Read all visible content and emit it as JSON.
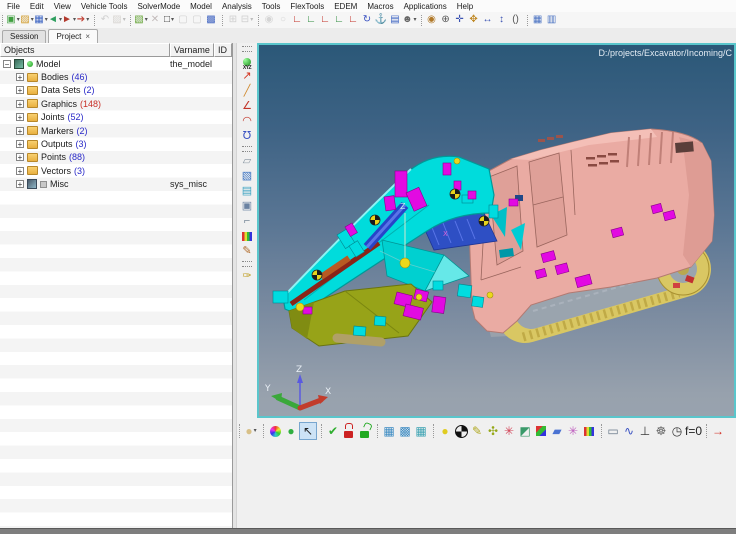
{
  "menu_bar": {
    "items": [
      "File",
      "Edit",
      "View",
      "Vehicle Tools",
      "SolverMode",
      "Model",
      "Analysis",
      "Tools",
      "FlexTools",
      "EDEM",
      "Macros",
      "Applications",
      "Help"
    ]
  },
  "top_toolbar": {
    "groups": [
      [
        {
          "name": "new-model",
          "glyph": "▣",
          "color": "#3f9f3f",
          "dropdown": true
        },
        {
          "name": "open-model",
          "glyph": "▨",
          "color": "#d09a28",
          "dropdown": true
        },
        {
          "name": "save-model",
          "glyph": "▦",
          "color": "#3a62c2",
          "dropdown": true
        },
        {
          "name": "import-file",
          "glyph": "◄",
          "color": "#2f9f5f",
          "dropdown": true
        },
        {
          "name": "export-file",
          "glyph": "►",
          "color": "#b23a2e",
          "dropdown": true
        },
        {
          "name": "export-video",
          "glyph": "➔",
          "color": "#c24438",
          "dropdown": true
        }
      ],
      [
        {
          "name": "undo",
          "glyph": "↶",
          "color": "#888",
          "dis": true
        },
        {
          "name": "open-recent",
          "glyph": "▨",
          "color": "#c09040",
          "dis": true,
          "dropdown": true
        }
      ],
      [
        {
          "name": "new-window",
          "glyph": "▧",
          "color": "#5fa02f",
          "dropdown": true
        },
        {
          "name": "delete",
          "glyph": "✕",
          "color": "#c23428",
          "dis": true
        },
        {
          "name": "select-rectangle",
          "glyph": "□",
          "color": "#333",
          "dropdown": true
        },
        {
          "name": "undo-view",
          "glyph": "▢",
          "color": "#888",
          "dis": true
        },
        {
          "name": "redo-view",
          "glyph": "▢",
          "color": "#888",
          "dis": true
        },
        {
          "name": "screen-capture",
          "glyph": "▩",
          "color": "#3e62c0"
        }
      ],
      [
        {
          "name": "copy",
          "glyph": "⊞",
          "color": "#888",
          "dis": true
        },
        {
          "name": "paste",
          "glyph": "⊟",
          "color": "#888",
          "dis": true,
          "dropdown": true
        }
      ],
      [
        {
          "name": "zoom-previous",
          "glyph": "◉",
          "color": "#999",
          "dis": true
        },
        {
          "name": "zoom-next",
          "glyph": "○",
          "color": "#999",
          "dis": true
        },
        {
          "name": "view-front",
          "glyph": "∟",
          "color": "#c22c22"
        },
        {
          "name": "view-right",
          "glyph": "∟",
          "color": "#2a8a3a"
        },
        {
          "name": "view-top",
          "glyph": "∟",
          "color": "#c22c22"
        },
        {
          "name": "view-iso",
          "glyph": "∟",
          "color": "#2a8a3a"
        },
        {
          "name": "view-bottom",
          "glyph": "∟",
          "color": "#c22c22"
        },
        {
          "name": "view-rotate",
          "glyph": "↻",
          "color": "#3a52c2"
        },
        {
          "name": "view-anchor",
          "glyph": "⚓",
          "color": "#2a52a2"
        },
        {
          "name": "render-page",
          "glyph": "▤",
          "color": "#3a62c2"
        },
        {
          "name": "browser-person",
          "glyph": "☻",
          "color": "#666",
          "dropdown": true
        }
      ],
      [
        {
          "name": "zoom-dynamic",
          "glyph": "◉",
          "color": "#b07828"
        },
        {
          "name": "zoom-in-out",
          "glyph": "⊕",
          "color": "#555"
        },
        {
          "name": "translate-view",
          "glyph": "✛",
          "color": "#3a52b2"
        },
        {
          "name": "pan-view",
          "glyph": "✥",
          "color": "#c08a28"
        },
        {
          "name": "fit-horizontal",
          "glyph": "↔",
          "color": "#3a52b2"
        },
        {
          "name": "fit-vertical",
          "glyph": "↕",
          "color": "#3a52b2"
        },
        {
          "name": "perspective",
          "glyph": "()",
          "color": "#555"
        }
      ],
      [
        {
          "name": "tile-windows",
          "glyph": "▦",
          "color": "#4a72c2"
        },
        {
          "name": "cascade-windows",
          "glyph": "▥",
          "color": "#4a72c2"
        }
      ]
    ]
  },
  "panel_tabs": {
    "session": "Session",
    "project": "Project",
    "close": "×"
  },
  "tree": {
    "headers": [
      "Objects",
      "Varname",
      "ID"
    ],
    "items": [
      {
        "label": "Model",
        "count": "",
        "varname": "the_model",
        "expander": "−"
      },
      {
        "label": "Bodies",
        "count": "(46)",
        "varname": "",
        "expander": "+"
      },
      {
        "label": "Data Sets",
        "count": "(2)",
        "varname": "",
        "expander": "+"
      },
      {
        "label": "Graphics",
        "count": "(148)",
        "varname": "",
        "expander": "+"
      },
      {
        "label": "Joints",
        "count": "(52)",
        "varname": "",
        "expander": "+"
      },
      {
        "label": "Markers",
        "count": "(2)",
        "varname": "",
        "expander": "+"
      },
      {
        "label": "Outputs",
        "count": "(3)",
        "varname": "",
        "expander": "+"
      },
      {
        "label": "Points",
        "count": "(88)",
        "varname": "",
        "expander": "+"
      },
      {
        "label": "Vectors",
        "count": "(3)",
        "varname": "",
        "expander": "+"
      },
      {
        "label": "Misc",
        "count": "",
        "varname": "sys_misc",
        "expander": "+"
      }
    ]
  },
  "left_toolbar": {
    "groups": [
      [
        {
          "name": "point-xyz",
          "cls": "xyz-ball",
          "sub": "XYZ"
        },
        {
          "name": "arrow-marker",
          "glyph": "↗",
          "color": "#d23420"
        },
        {
          "name": "line-tool",
          "glyph": "╱",
          "color": "#d08a30"
        },
        {
          "name": "polyline-tool",
          "glyph": "∠",
          "color": "#c23428"
        },
        {
          "name": "arc-tool",
          "glyph": "◠",
          "color": "#c23428"
        },
        {
          "name": "spline-tool",
          "glyph": "℧",
          "color": "#3a52c2"
        }
      ],
      [
        {
          "name": "plane-tool",
          "glyph": "▱",
          "color": "#8a96a2"
        },
        {
          "name": "render-settings",
          "glyph": "▧",
          "color": "#3a72c2"
        },
        {
          "name": "appearance-monitor",
          "glyph": "▤",
          "color": "#3aa2c2"
        },
        {
          "name": "view-part",
          "glyph": "▣",
          "color": "#6a82a2"
        },
        {
          "name": "corner-tool",
          "glyph": "⌐",
          "color": "#7a8a9a"
        },
        {
          "name": "measure-ruler",
          "cls": "bars"
        },
        {
          "name": "pencil-sphere",
          "glyph": "✎",
          "color": "#b06a28"
        }
      ],
      [
        {
          "name": "sweep-tool",
          "glyph": "✑",
          "color": "#c0a028"
        }
      ]
    ]
  },
  "viewport": {
    "path_text": "D:/projects/Excavator/Incoming/C",
    "triad": {
      "x": "X",
      "y": "Y",
      "z": "Z"
    },
    "marker_labels": {
      "z": "Z",
      "x": "X"
    }
  },
  "bottom_toolbar": {
    "groups": [
      [
        {
          "name": "render-mode",
          "glyph": "●",
          "color": "#d8c088",
          "dropdown": true
        }
      ],
      [
        {
          "name": "color-wheel",
          "cls": "wheel"
        },
        {
          "name": "shaded-mode",
          "glyph": "●",
          "color": "#2fae3f"
        },
        {
          "name": "select-pointer",
          "glyph": "↖",
          "color": "#222",
          "active": true
        }
      ],
      [
        {
          "name": "verify-check",
          "glyph": "✔",
          "color": "#2fae2f"
        },
        {
          "name": "lock-closed",
          "cls": "lock-red"
        },
        {
          "name": "lock-open",
          "cls": "lock-green"
        }
      ],
      [
        {
          "name": "view-layout-1",
          "glyph": "▦",
          "color": "#3a8ac2"
        },
        {
          "name": "view-layout-2",
          "glyph": "▩",
          "color": "#3a8ac2"
        },
        {
          "name": "view-layout-3",
          "glyph": "▦",
          "color": "#3aa2b2"
        }
      ],
      [
        {
          "name": "sphere-marker",
          "glyph": "●",
          "color": "#e0cc20"
        },
        {
          "name": "inertia-marker",
          "cls": "target"
        },
        {
          "name": "pencil-dart",
          "glyph": "✎",
          "color": "#b0a820"
        },
        {
          "name": "propeller-marker",
          "glyph": "✣",
          "color": "#96a818"
        },
        {
          "name": "star-marker",
          "glyph": "✳",
          "color": "#d24458"
        },
        {
          "name": "plane-stack",
          "glyph": "◩",
          "color": "#3a9a6a"
        },
        {
          "name": "rgb-cube",
          "cls": "cube"
        },
        {
          "name": "blue-plane",
          "glyph": "▰",
          "color": "#4a72d2"
        },
        {
          "name": "asterisk-marker",
          "glyph": "✳",
          "color": "#c060c0"
        },
        {
          "name": "color-bars",
          "cls": "bars"
        }
      ],
      [
        {
          "name": "vehicle-tool",
          "glyph": "▭",
          "color": "#6a7a8a"
        },
        {
          "name": "spring-damper",
          "glyph": "∿",
          "color": "#3a52c2"
        },
        {
          "name": "joint-tool",
          "glyph": "⊥",
          "color": "#3a3a3a"
        },
        {
          "name": "gear-tool",
          "glyph": "☸",
          "color": "#666"
        },
        {
          "name": "stopwatch",
          "glyph": "◷",
          "color": "#333"
        },
        {
          "name": "force-zero",
          "glyph": "f=0",
          "color": "#222"
        }
      ],
      [
        {
          "name": "run-arrow",
          "glyph": "→",
          "color": "#d22418"
        }
      ]
    ]
  },
  "colors": {
    "viewport_top": "#2b5878",
    "viewport_bottom": "#99a3ae",
    "selection_border": "#5ac6cc",
    "body": "#eaaba3",
    "boom": "#00dcdc",
    "bucket": "#97a318",
    "track": "#d9c763",
    "marker": "#e20ae2"
  }
}
